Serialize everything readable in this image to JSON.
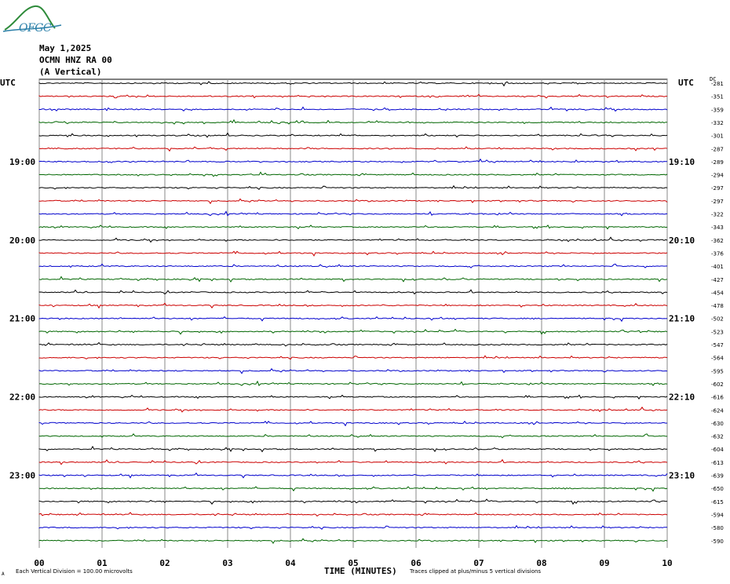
{
  "header": {
    "logo_text": "OFGC",
    "date": "May 1,2025",
    "station": "OCMN HNZ RA 00",
    "component": "(A Vertical)",
    "utc_left": "UTC",
    "utc_right": "UTC",
    "dc_label": "DC"
  },
  "footer": {
    "division": "Each Vertical Division =  100.00 microvolts",
    "xlabel": "TIME (MINUTES)",
    "clip_note": "Traces clipped at plus/minus 5 vertical divisions",
    "mark": "A"
  },
  "colors": {
    "black": "#000000",
    "red": "#cc0000",
    "blue": "#0000cc",
    "green": "#006600",
    "grid": "#888888"
  },
  "chart_data": {
    "type": "line",
    "title": "",
    "xlabel": "TIME (MINUTES)",
    "ylabel": "",
    "xlim": [
      0,
      10
    ],
    "x_ticks": [
      "00",
      "01",
      "02",
      "03",
      "04",
      "05",
      "06",
      "07",
      "08",
      "09",
      "10"
    ],
    "trace_colors_cycle": [
      "black",
      "red",
      "blue",
      "green"
    ],
    "left_time_labels": [
      {
        "trace": 6,
        "label": "19:00"
      },
      {
        "trace": 12,
        "label": "20:00"
      },
      {
        "trace": 18,
        "label": "21:00"
      },
      {
        "trace": 24,
        "label": "22:00"
      },
      {
        "trace": 30,
        "label": "23:00"
      }
    ],
    "right_time_labels": [
      {
        "trace": 6,
        "label": "19:10"
      },
      {
        "trace": 12,
        "label": "20:10"
      },
      {
        "trace": 18,
        "label": "21:10"
      },
      {
        "trace": 24,
        "label": "22:10"
      },
      {
        "trace": 30,
        "label": "23:10"
      }
    ],
    "dc_offsets": [
      -281,
      -351,
      -359,
      -332,
      -301,
      -287,
      -289,
      -294,
      -297,
      -297,
      -322,
      -343,
      -362,
      -376,
      -401,
      -427,
      -454,
      -478,
      -502,
      -523,
      -547,
      -564,
      -595,
      -602,
      -616,
      -624,
      -630,
      -632,
      -604,
      -613,
      -639,
      -650,
      -615,
      -594,
      -580,
      -590
    ],
    "grid": true
  }
}
